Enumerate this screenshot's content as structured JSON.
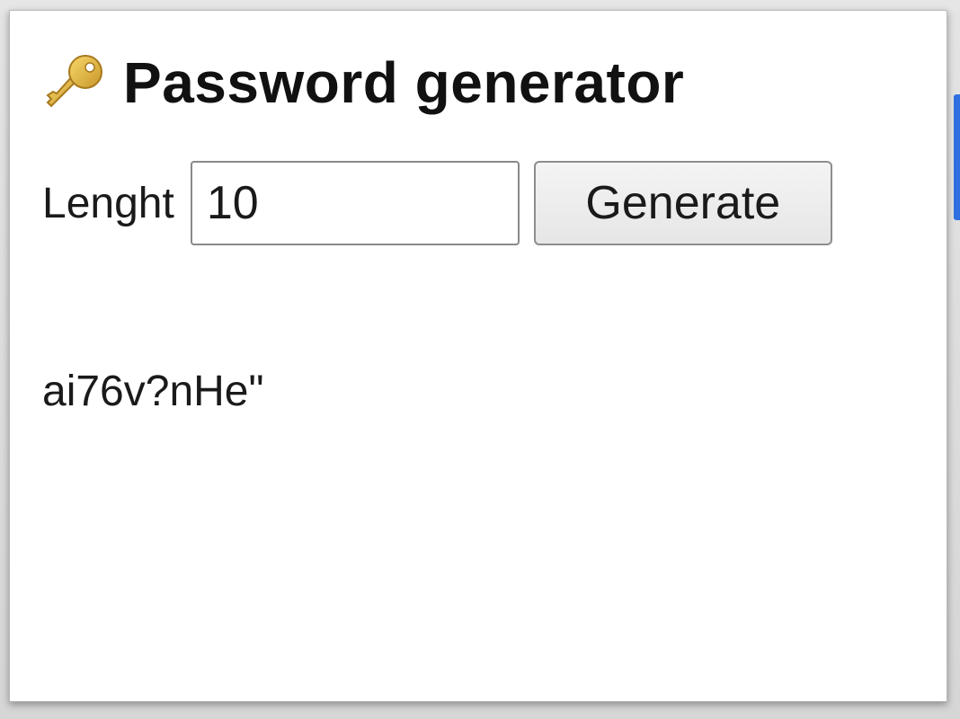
{
  "popup": {
    "title": "Password generator",
    "title_icon": "key-icon",
    "length_label": "Lenght",
    "length_value": "10",
    "generate_label": "Generate",
    "generated_password": "ai76v?nHe\""
  },
  "colors": {
    "accent": "#2f6fe0",
    "key_gold": "#e2b43a",
    "text": "#1a1a1a",
    "button_bg": "#ececec"
  }
}
